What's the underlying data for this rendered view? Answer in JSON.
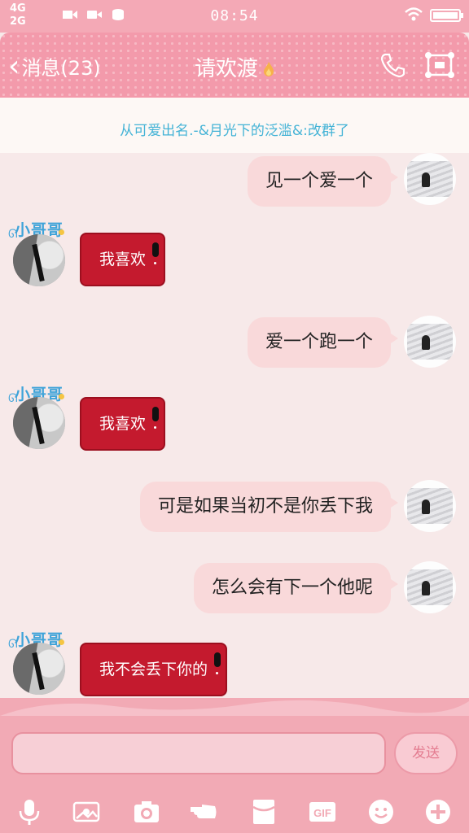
{
  "status_bar": {
    "network_1": "4G",
    "network_2": "2G",
    "time": "08:54"
  },
  "header": {
    "back_label": "消息(23)",
    "title": "请欢渡"
  },
  "notice": {
    "text": "从可爱出名.-&月光下的泛滥&:改群了"
  },
  "contact": {
    "nickname": "小哥哥"
  },
  "messages": [
    {
      "from": "me",
      "text": "见一个爱一个"
    },
    {
      "from": "other",
      "text": "我喜欢"
    },
    {
      "from": "me",
      "text": "爱一个跑一个"
    },
    {
      "from": "other",
      "text": "我喜欢"
    },
    {
      "from": "me",
      "text": "可是如果当初不是你丢下我"
    },
    {
      "from": "me",
      "text": "怎么会有下一个他呢"
    },
    {
      "from": "other",
      "text": "我不会丢下你的"
    }
  ],
  "input": {
    "send_label": "发送"
  },
  "toolbar": {
    "items": [
      "microphone-icon",
      "image-icon",
      "camera-icon",
      "poke-icon",
      "red-packet-icon",
      "gif-icon",
      "emoji-icon",
      "plus-icon"
    ],
    "gif_label": "GIF"
  },
  "colors": {
    "header": "#f39aab",
    "my_bubble": "#f9d9da",
    "other_bubble": "#c41a2e",
    "notice_text": "#44b3d6",
    "nickname": "#3ea3d9"
  }
}
